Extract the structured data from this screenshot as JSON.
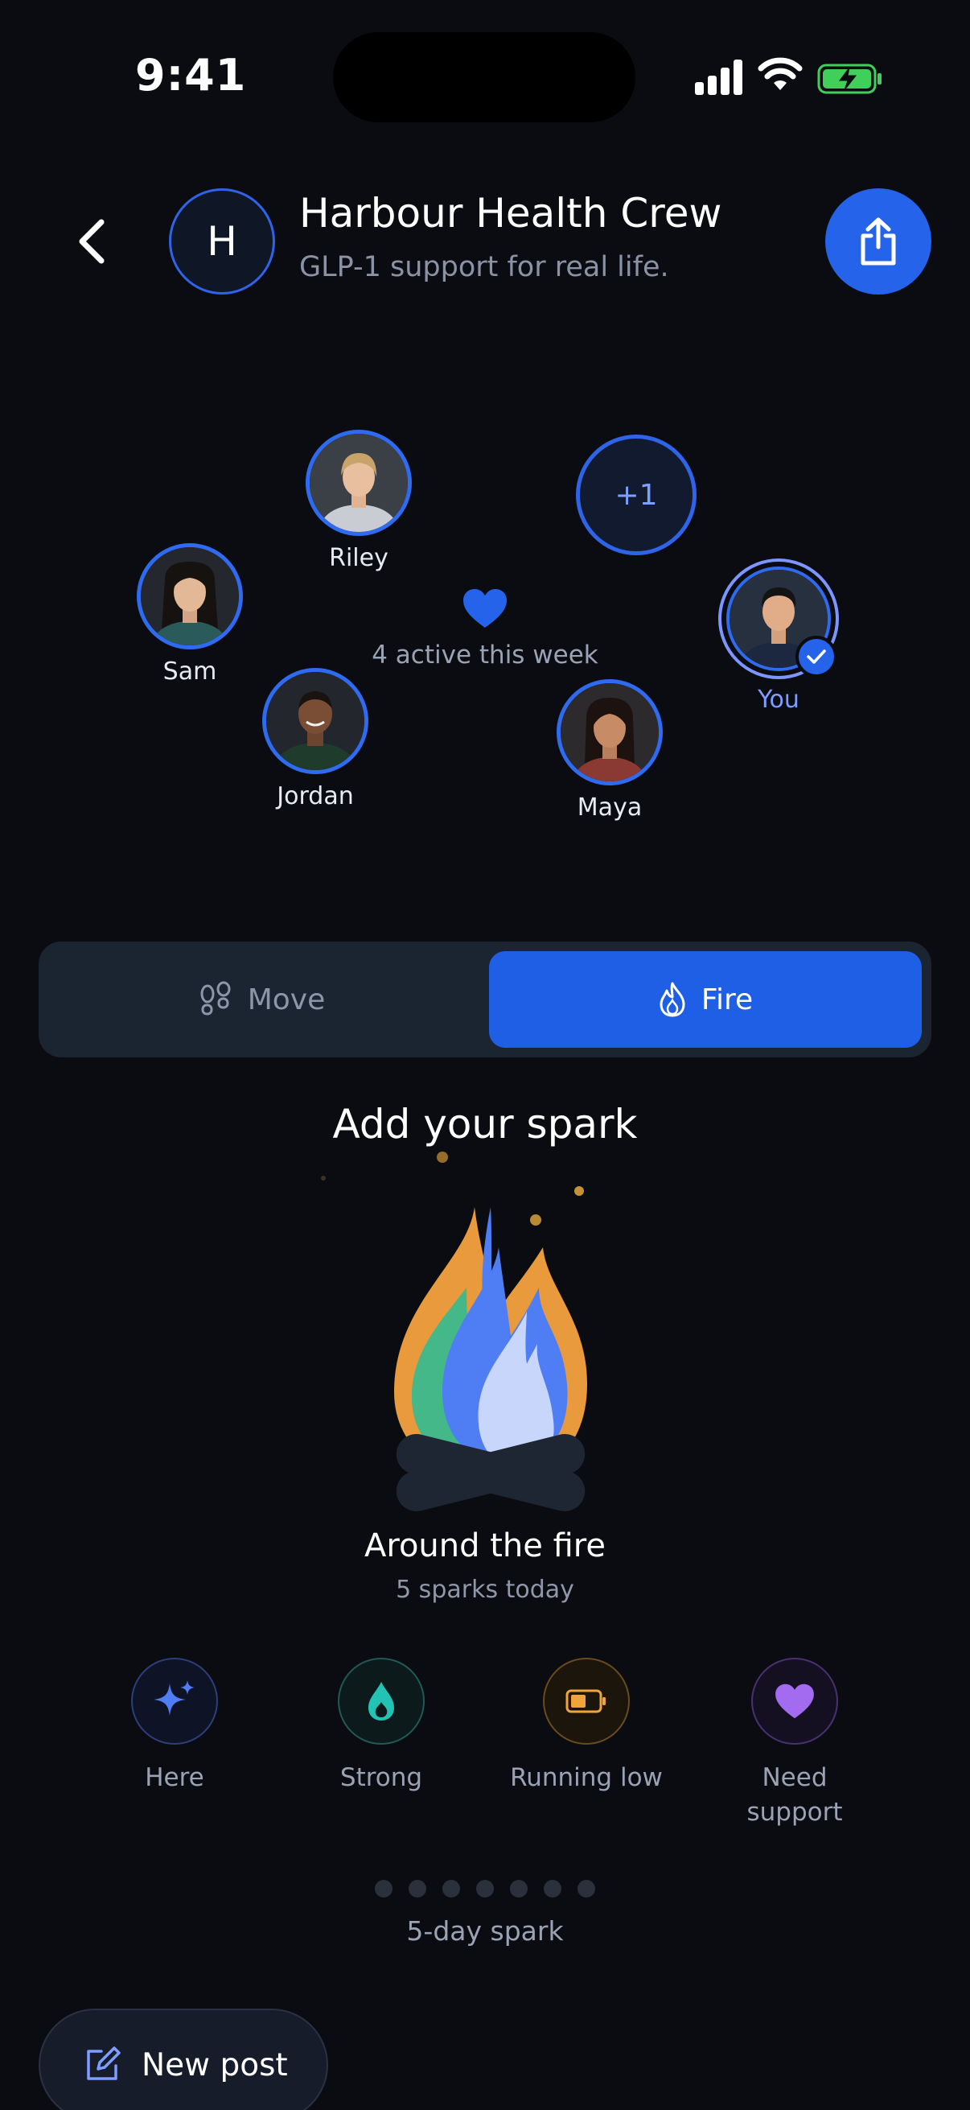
{
  "status_bar": {
    "time": "9:41"
  },
  "header": {
    "avatar_letter": "H",
    "title": "Harbour Health Crew",
    "subtitle": "GLP-1 support for real life."
  },
  "members": [
    {
      "name": "Riley"
    },
    {
      "name": "Sam"
    },
    {
      "name": "Jordan"
    },
    {
      "name": "Maya"
    },
    {
      "name": "You"
    }
  ],
  "extra_members": "+1",
  "active_text": "4 active this week",
  "toggle": {
    "move_label": "Move",
    "fire_label": "Fire",
    "selected": "Fire"
  },
  "fire": {
    "heading": "Add your spark",
    "title": "Around the fire",
    "subtitle": "5 sparks today"
  },
  "moods": [
    {
      "label": "Here",
      "icon": "sparkles-icon",
      "color": "#4f7df3"
    },
    {
      "label": "Strong",
      "icon": "droplet-icon",
      "color": "#22c3b5"
    },
    {
      "label": "Running low",
      "icon": "battery-low-icon",
      "color": "#f0a43a"
    },
    {
      "label": "Need support",
      "icon": "heart-icon",
      "color": "#a36cf0"
    }
  ],
  "streak": {
    "dots": 7,
    "label": "5-day spark"
  },
  "new_post_label": "New post",
  "colors": {
    "accent": "#2563eb",
    "background": "#0a0c12",
    "surface": "#1b2431"
  }
}
